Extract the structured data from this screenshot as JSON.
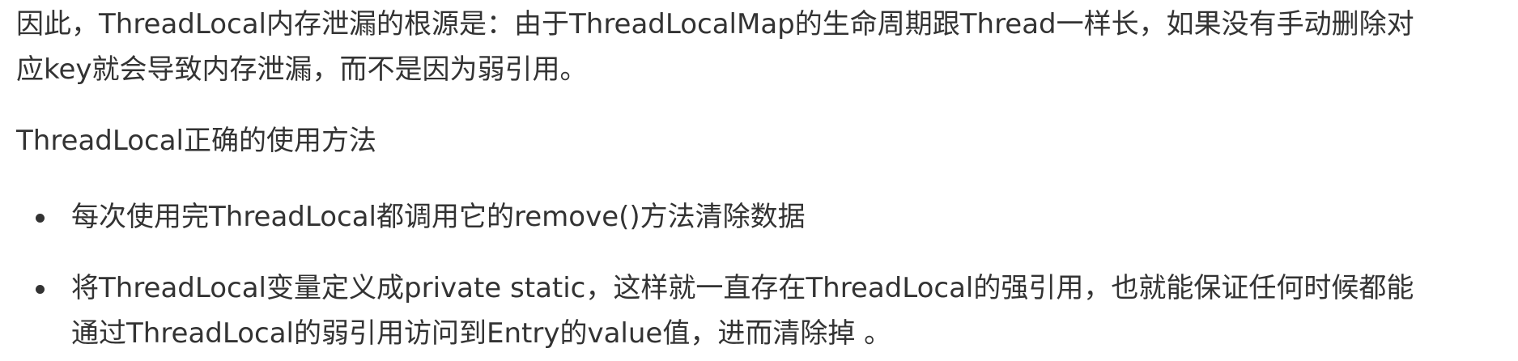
{
  "paragraph1": {
    "line1": "因此，ThreadLocal内存泄漏的根源是：由于ThreadLocalMap的生命周期跟Thread一样长，如果没有手动删除对",
    "line2": "应key就会导致内存泄漏，而不是因为弱引用。"
  },
  "paragraph2": "ThreadLocal正确的使用方法",
  "bullets": [
    {
      "lines": [
        "每次使用完ThreadLocal都调用它的remove()方法清除数据"
      ]
    },
    {
      "lines": [
        "将ThreadLocal变量定义成private static，这样就一直存在ThreadLocal的强引用，也就能保证任何时候都能",
        "通过ThreadLocal的弱引用访问到Entry的value值，进而清除掉 。"
      ]
    }
  ]
}
